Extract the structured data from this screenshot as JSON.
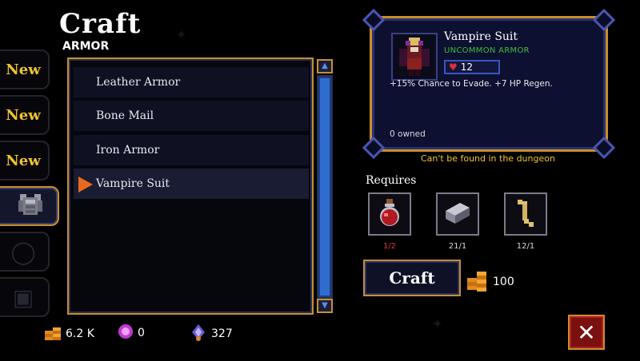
{
  "header": {
    "title": "Craft",
    "category": "ARMOR"
  },
  "categories": [
    {
      "type": "new",
      "label": "New",
      "icon": "sword-icon"
    },
    {
      "type": "new",
      "label": "New",
      "icon": "sword-icon"
    },
    {
      "type": "new",
      "label": "New",
      "icon": "shield-icon"
    },
    {
      "type": "selected",
      "icon": "chestplate-armor-icon"
    },
    {
      "type": "dim",
      "icon": "ring-icon"
    },
    {
      "type": "dim",
      "icon": "crate-icon"
    }
  ],
  "item_list": [
    {
      "name": "Leather Armor",
      "selected": false
    },
    {
      "name": "Bone Mail",
      "selected": false
    },
    {
      "name": "Iron Armor",
      "selected": false
    },
    {
      "name": "Vampire Suit",
      "selected": true
    }
  ],
  "currencies": [
    {
      "icon": "gold-coins-icon",
      "value": "6.2 K"
    },
    {
      "icon": "purple-gem-icon",
      "value": "0"
    },
    {
      "icon": "soul-crystal-icon",
      "value": "327"
    }
  ],
  "detail": {
    "name": "Vampire Suit",
    "rarity": "UNCOMMON ARMOR",
    "hp": "12",
    "description": "+15% Chance to Evade. +7 HP Regen.",
    "owned": "0 owned",
    "source_note": "Can't be found in the dungeon"
  },
  "requires": {
    "label": "Requires",
    "items": [
      {
        "icon": "red-potion-icon",
        "count": "1/2",
        "sufficient": false
      },
      {
        "icon": "iron-ingot-icon",
        "count": "21/1",
        "sufficient": true
      },
      {
        "icon": "bone-icon",
        "count": "12/1",
        "sufficient": true
      }
    ]
  },
  "craft": {
    "label": "Craft",
    "cost": "100",
    "cost_icon": "gold-coins-icon"
  },
  "colors": {
    "accent_gold": "#c88f2a",
    "rarity_green": "#3fbf3a",
    "new_yellow": "#f0c52b",
    "insufficient_red": "#e0303a",
    "scroll_blue": "#2f6cd0"
  }
}
